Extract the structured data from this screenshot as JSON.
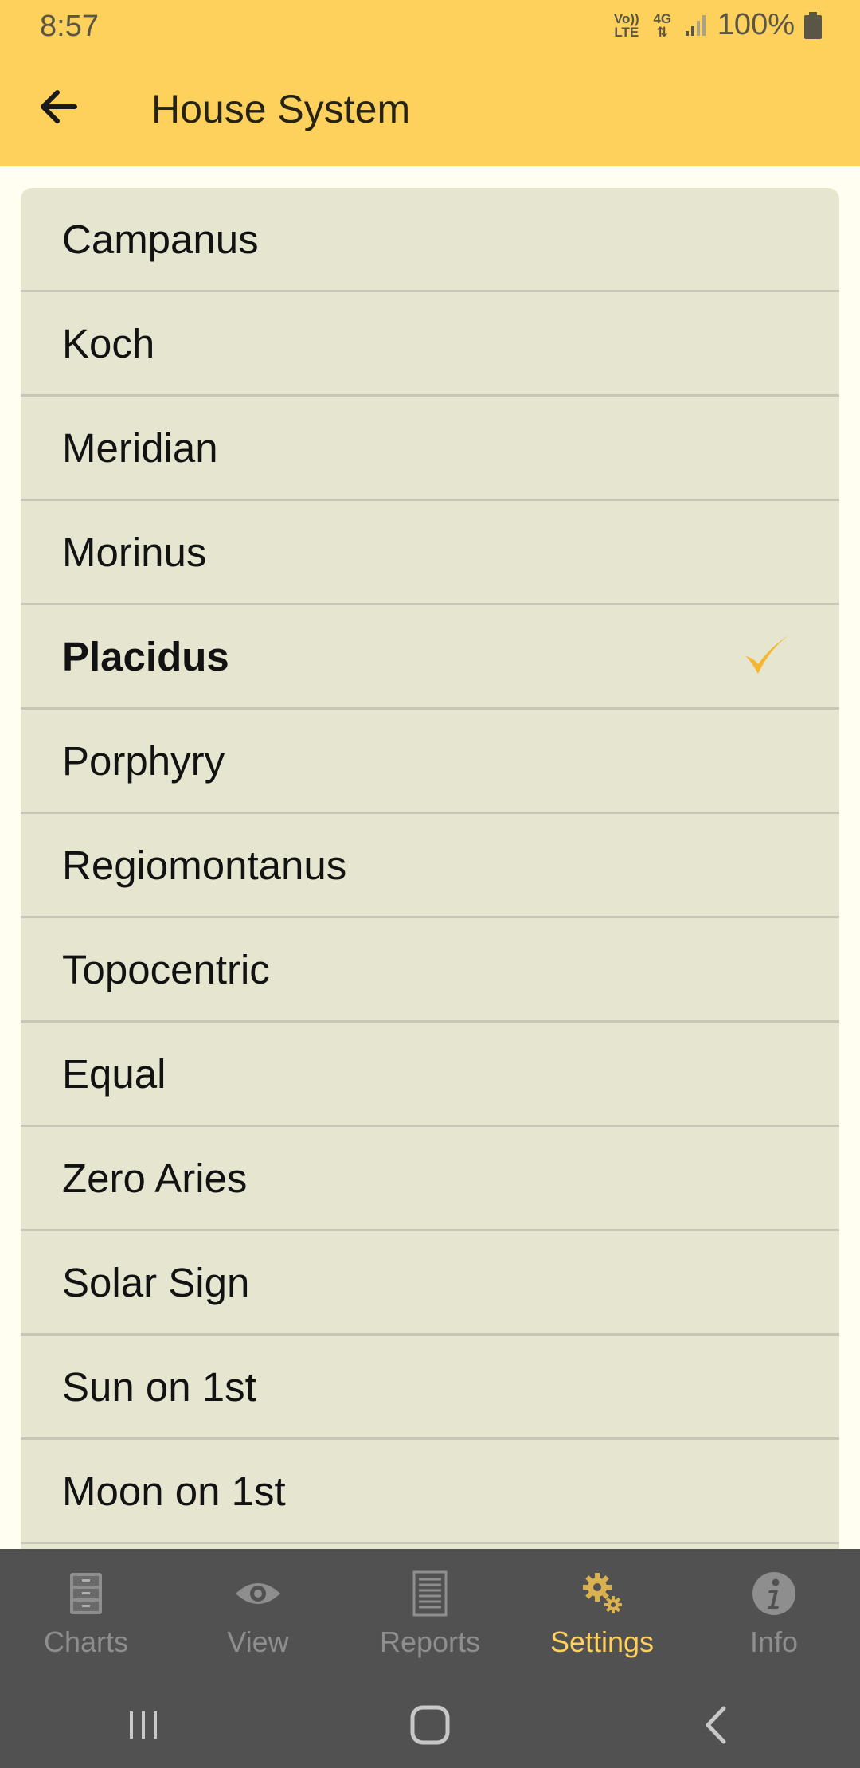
{
  "status_bar": {
    "time": "8:57",
    "volte_top": "Vo))",
    "volte_bottom": "LTE",
    "network": "4G",
    "battery": "100%"
  },
  "app_bar": {
    "title": "House System",
    "back_icon": "arrow-left-icon"
  },
  "house_systems": {
    "items": [
      {
        "label": "Campanus"
      },
      {
        "label": "Koch"
      },
      {
        "label": "Meridian"
      },
      {
        "label": "Morinus"
      },
      {
        "label": "Placidus",
        "selected": true
      },
      {
        "label": "Porphyry"
      },
      {
        "label": "Regiomontanus"
      },
      {
        "label": "Topocentric"
      },
      {
        "label": "Equal"
      },
      {
        "label": "Zero Aries"
      },
      {
        "label": "Solar Sign"
      },
      {
        "label": "Sun on 1st"
      },
      {
        "label": "Moon on 1st"
      }
    ]
  },
  "bottom_nav": {
    "tabs": [
      {
        "label": "Charts",
        "icon": "file-cabinet-icon"
      },
      {
        "label": "View",
        "icon": "eye-icon"
      },
      {
        "label": "Reports",
        "icon": "document-icon"
      },
      {
        "label": "Settings",
        "icon": "gears-icon",
        "active": true
      },
      {
        "label": "Info",
        "icon": "info-icon"
      }
    ]
  },
  "system_nav": {
    "recents": "recents-icon",
    "home": "home-icon",
    "back": "back-icon"
  },
  "colors": {
    "app_bar": "#fed05c",
    "list_bg": "#e6e5d0",
    "accent_check": "#f5b632",
    "nav_bg": "#515151",
    "nav_active": "#fed05c",
    "nav_inactive": "#8e8e8e"
  }
}
